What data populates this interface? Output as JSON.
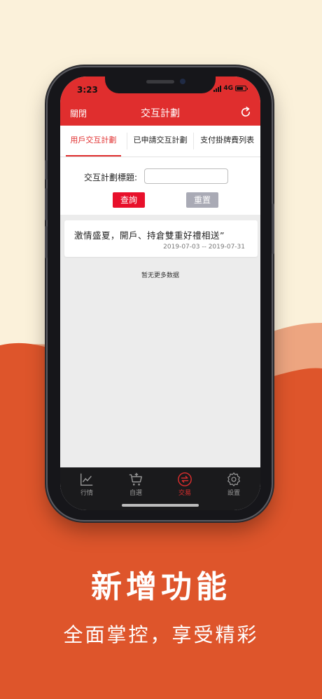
{
  "colors": {
    "accent": "#e02e2e",
    "query": "#e8102b",
    "reset": "#a9aab5",
    "bg_top": "#fbf1da",
    "wave_dark": "#de552b",
    "wave_light": "#eda580"
  },
  "status_bar": {
    "time": "3:23",
    "network": "4G"
  },
  "nav": {
    "close": "關閉",
    "title": "交互計劃",
    "refresh_icon": "refresh-icon"
  },
  "tabs": [
    {
      "label": "用戶交互計劃",
      "active": true
    },
    {
      "label": "已申請交互計劃",
      "active": false
    },
    {
      "label": "支付掛牌費列表",
      "active": false
    }
  ],
  "search": {
    "label": "交互計劃標題:",
    "value": "",
    "placeholder": "",
    "query_button": "查詢",
    "reset_button": "重置"
  },
  "plans": [
    {
      "title": "激情盛夏，開戶、持倉雙重好禮相送”",
      "date_range": "2019-07-03 -- 2019-07-31"
    }
  ],
  "no_more_text": "暂无更多数据",
  "bottom_tabs": [
    {
      "label": "行情",
      "icon": "chart-line-icon",
      "active": false
    },
    {
      "label": "自選",
      "icon": "cart-add-icon",
      "active": false
    },
    {
      "label": "交易",
      "icon": "exchange-icon",
      "active": true
    },
    {
      "label": "設置",
      "icon": "gear-icon",
      "active": false
    }
  ],
  "promo": {
    "title": "新增功能",
    "subtitle": "全面掌控，享受精彩"
  }
}
